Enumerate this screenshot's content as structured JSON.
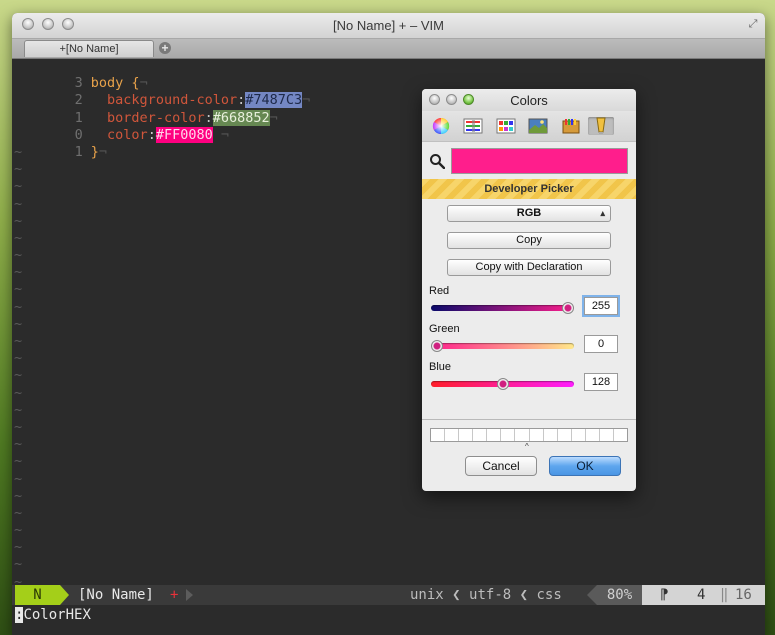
{
  "window": {
    "title": "[No Name] + – VIM",
    "tab_label": "+[No Name]",
    "tab_add": "+",
    "fullscreen_icon": "expand-arrows"
  },
  "editor": {
    "lines": [
      {
        "num": "3",
        "selector": "body",
        "open": " {",
        "eol": "¬"
      },
      {
        "num": "2",
        "prop": "background-color",
        "colon": ":",
        "value": "#7487C3",
        "eol": "¬"
      },
      {
        "num": "1",
        "prop": "border-color",
        "colon": ":",
        "value": "#668852",
        "eol": "¬"
      },
      {
        "num": "0",
        "prop": "color",
        "colon": ":",
        "value": "#FF0080",
        "eol": " ¬"
      },
      {
        "num": "1",
        "close": "}",
        "eol": "¬"
      }
    ],
    "tilde": "~",
    "tilde_count": 26,
    "colors": {
      "v1": "#7487c3",
      "v2": "#668852",
      "v3": "#ff0080"
    }
  },
  "statusbar": {
    "mode": "N",
    "buffer": "[No Name]",
    "modified": "+",
    "format": "unix",
    "encoding": "utf-8",
    "filetype": "css",
    "sep": "❮",
    "percent": "80%",
    "line_flag": "⁋",
    "line": "4",
    "pipe": "‖",
    "total": "16"
  },
  "cmdline": {
    "cursor": ":",
    "text": "ColorHEX"
  },
  "colors_panel": {
    "title": "Colors",
    "section": "Developer Picker",
    "mode_select": "RGB",
    "copy_label": "Copy",
    "copy_decl_label": "Copy with Declaration",
    "current_color": "#ff1e8c",
    "sliders": [
      {
        "label": "Red",
        "value": "255",
        "fraction": 1.0
      },
      {
        "label": "Green",
        "value": "0",
        "fraction": 0.0
      },
      {
        "label": "Blue",
        "value": "128",
        "fraction": 0.5
      }
    ],
    "cancel_label": "Cancel",
    "ok_label": "OK",
    "caret": "^",
    "tools": [
      "color-wheel-icon",
      "color-sliders-icon",
      "color-palettes-icon",
      "image-palettes-icon",
      "crayons-icon",
      "developer-picker-icon"
    ]
  }
}
